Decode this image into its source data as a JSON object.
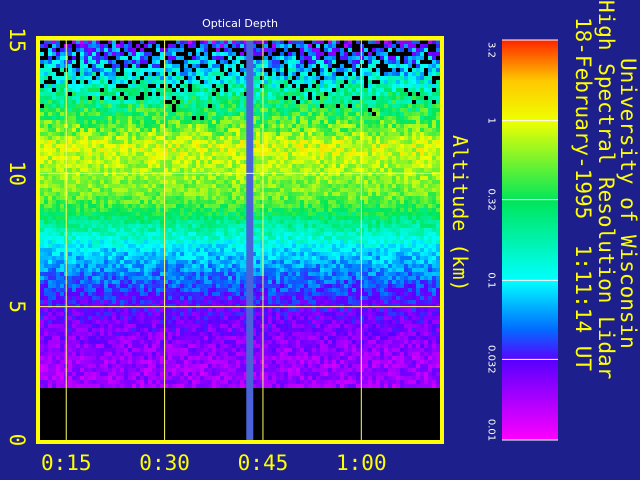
{
  "chart_data": {
    "type": "heatmap",
    "title": "Optical Depth",
    "ylabel": "Altitude (km)",
    "xlabel": "",
    "x_ticks": [
      "0:15",
      "0:30",
      "0:45",
      "1:00"
    ],
    "y_ticks": [
      "0",
      "5",
      "10",
      "15"
    ],
    "xlim": [
      "0:11",
      "1:12"
    ],
    "ylim": [
      0,
      15
    ],
    "grid": true,
    "x_grid_times": [
      0.25,
      0.5,
      0.75,
      1.0
    ],
    "y_grid_km": [
      5,
      10,
      15
    ],
    "colorbar": {
      "scale": "log",
      "ticks": [
        "0.01",
        "0.032",
        "0.1",
        "0.32",
        "1",
        "3.2"
      ],
      "range": [
        0.01,
        3.2
      ]
    },
    "observations": {
      "ground_blank_below_km": 2.0,
      "data_gap_time": "0:42",
      "aerosol_layer_km": [
        7.5,
        12
      ],
      "description_values": [
        {
          "altitude_km": 1,
          "optical_depth": null
        },
        {
          "altitude_km": 3,
          "optical_depth": 0.02
        },
        {
          "altitude_km": 5,
          "optical_depth": 0.03
        },
        {
          "altitude_km": 7,
          "optical_depth": 0.08
        },
        {
          "altitude_km": 9,
          "optical_depth": 0.5
        },
        {
          "altitude_km": 11,
          "optical_depth": 0.9
        },
        {
          "altitude_km": 13,
          "optical_depth": 0.2
        },
        {
          "altitude_km": 15,
          "optical_depth": 0.03
        }
      ]
    }
  },
  "header": {
    "line1": "University of Wisconsin",
    "line2": "High Spectral Resolution Lidar",
    "line3_date": "18-February-1995",
    "line3_time": "1:11:14 UT"
  },
  "colors": {
    "background": "#1c1f8c",
    "frame": "#ffff00",
    "grid": "#ffff66",
    "gap_stripe": "#4a63d8",
    "ground": "#000000",
    "tick_text": "#ffff00",
    "header_text": "#ffff00"
  }
}
